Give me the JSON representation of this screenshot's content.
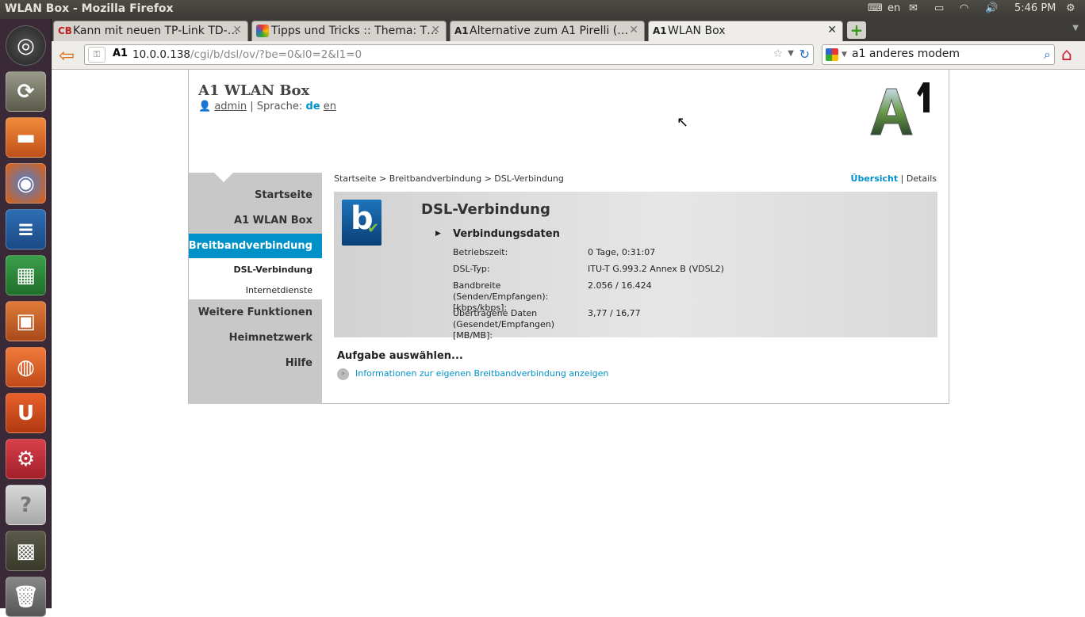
{
  "os_panel": {
    "window_title": "WLAN Box - Mozilla Firefox",
    "keyboard_layout": "en",
    "time": "5:46 PM"
  },
  "launcher": {
    "items": [
      {
        "name": "ubuntu-dash",
        "icon": "ubuntu-logo-icon"
      },
      {
        "name": "ubuntu-software-center",
        "icon": "installer-icon"
      },
      {
        "name": "files",
        "icon": "folder-icon"
      },
      {
        "name": "firefox",
        "icon": "firefox-icon"
      },
      {
        "name": "writer",
        "icon": "writer-icon"
      },
      {
        "name": "calc",
        "icon": "calc-icon"
      },
      {
        "name": "impress",
        "icon": "impress-icon"
      },
      {
        "name": "software-center",
        "icon": "shopping-bag-icon"
      },
      {
        "name": "ubuntu-one",
        "icon": "ubuntu-one-icon",
        "glyph": "U"
      },
      {
        "name": "system-settings",
        "icon": "settings-icon"
      },
      {
        "name": "help",
        "icon": "help-icon",
        "glyph": "?"
      },
      {
        "name": "workspaces",
        "icon": "workspace-icon"
      },
      {
        "name": "trash",
        "icon": "trash-icon"
      }
    ]
  },
  "browser": {
    "tabs": [
      {
        "label": "Kann mit neuen TP-Link TD-…",
        "favicon": "CB",
        "active": false
      },
      {
        "label": "Tipps und Tricks :: Thema: T…",
        "favicon": "",
        "active": false
      },
      {
        "label": "Alternative zum A1 Pirelli (…",
        "favicon": "A1",
        "active": false
      },
      {
        "label": "WLAN Box",
        "favicon": "A1",
        "active": true
      }
    ],
    "url_host": "10.0.0.138",
    "url_path": "/cgi/b/dsl/ov/?be=0&l0=2&l1=0",
    "site_identity": "A1",
    "search_value": "a1 anderes modem"
  },
  "page": {
    "header": {
      "title": "A1 WLAN Box",
      "user": "admin",
      "language_label": "| Sprache:",
      "lang_de": "de",
      "lang_en": "en",
      "logo_text": "A1"
    },
    "nav": {
      "items": [
        "Startseite",
        "A1 WLAN Box",
        "Breitbandverbindung",
        "Weitere Funktionen",
        "Heimnetzwerk",
        "Hilfe"
      ],
      "active": "Breitbandverbindung",
      "sub_items": [
        "DSL-Verbindung",
        "Internetdienste"
      ],
      "active_sub": "DSL-Verbindung"
    },
    "breadcrumb": "Startseite > Breitbandverbindung > DSL-Verbindung",
    "view_overview": "Übersicht",
    "view_separator": "|",
    "view_details": "Details",
    "panel": {
      "icon_letter": "b",
      "title": "DSL-Verbindung",
      "section": "Verbindungsdaten",
      "rows": [
        {
          "label": "Betriebszeit:",
          "value": "0 Tage, 0:31:07"
        },
        {
          "label": "DSL-Typ:",
          "value": "ITU-T G.993.2 Annex B (VDSL2)"
        },
        {
          "label": "Bandbreite (Senden/Empfangen): [kbps/kbps]:",
          "value": "2.056 / 16.424"
        },
        {
          "label": "Übertragene Daten (Gesendet/Empfangen) [MB/MB]:",
          "value": "3,77 / 16,77"
        }
      ]
    },
    "task": {
      "title": "Aufgabe auswählen...",
      "link": "Informationen zur eigenen Breitbandverbindung anzeigen"
    }
  }
}
